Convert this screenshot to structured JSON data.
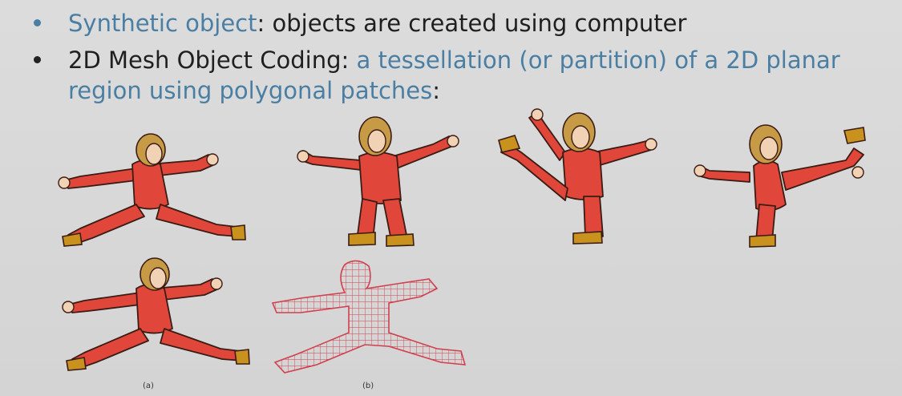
{
  "bullets": [
    {
      "segments": [
        {
          "text": "Synthetic object",
          "color": "#4a7fa3"
        },
        {
          "text": ": objects are created using computer",
          "color": "#1f1f1f"
        }
      ]
    },
    {
      "segments": [
        {
          "text": "2D Mesh Object Coding: ",
          "color": "#1f1f1f"
        },
        {
          "text": "a tessellation (or partition) of a 2D planar region using polygonal patches",
          "color": "#4a7fa3"
        },
        {
          "text": ":",
          "color": "#1f1f1f"
        }
      ]
    }
  ],
  "figure": {
    "captions": {
      "a": "(a)",
      "b": "(b)"
    },
    "figures": [
      {
        "name": "figure-cartoon-spread",
        "kind": "cartoon"
      },
      {
        "name": "figure-cartoon-arms-raised",
        "kind": "cartoon"
      },
      {
        "name": "figure-cartoon-high-kick",
        "kind": "cartoon"
      },
      {
        "name": "figure-cartoon-side-kick",
        "kind": "cartoon"
      },
      {
        "name": "figure-cartoon-a",
        "kind": "cartoon"
      },
      {
        "name": "figure-mesh-b",
        "kind": "mesh"
      }
    ],
    "colors": {
      "suit": "#e0473a",
      "outline": "#3a1c14",
      "hair": "#c79b46",
      "skin": "#f2d2b4",
      "mesh": "#d0404e"
    }
  }
}
